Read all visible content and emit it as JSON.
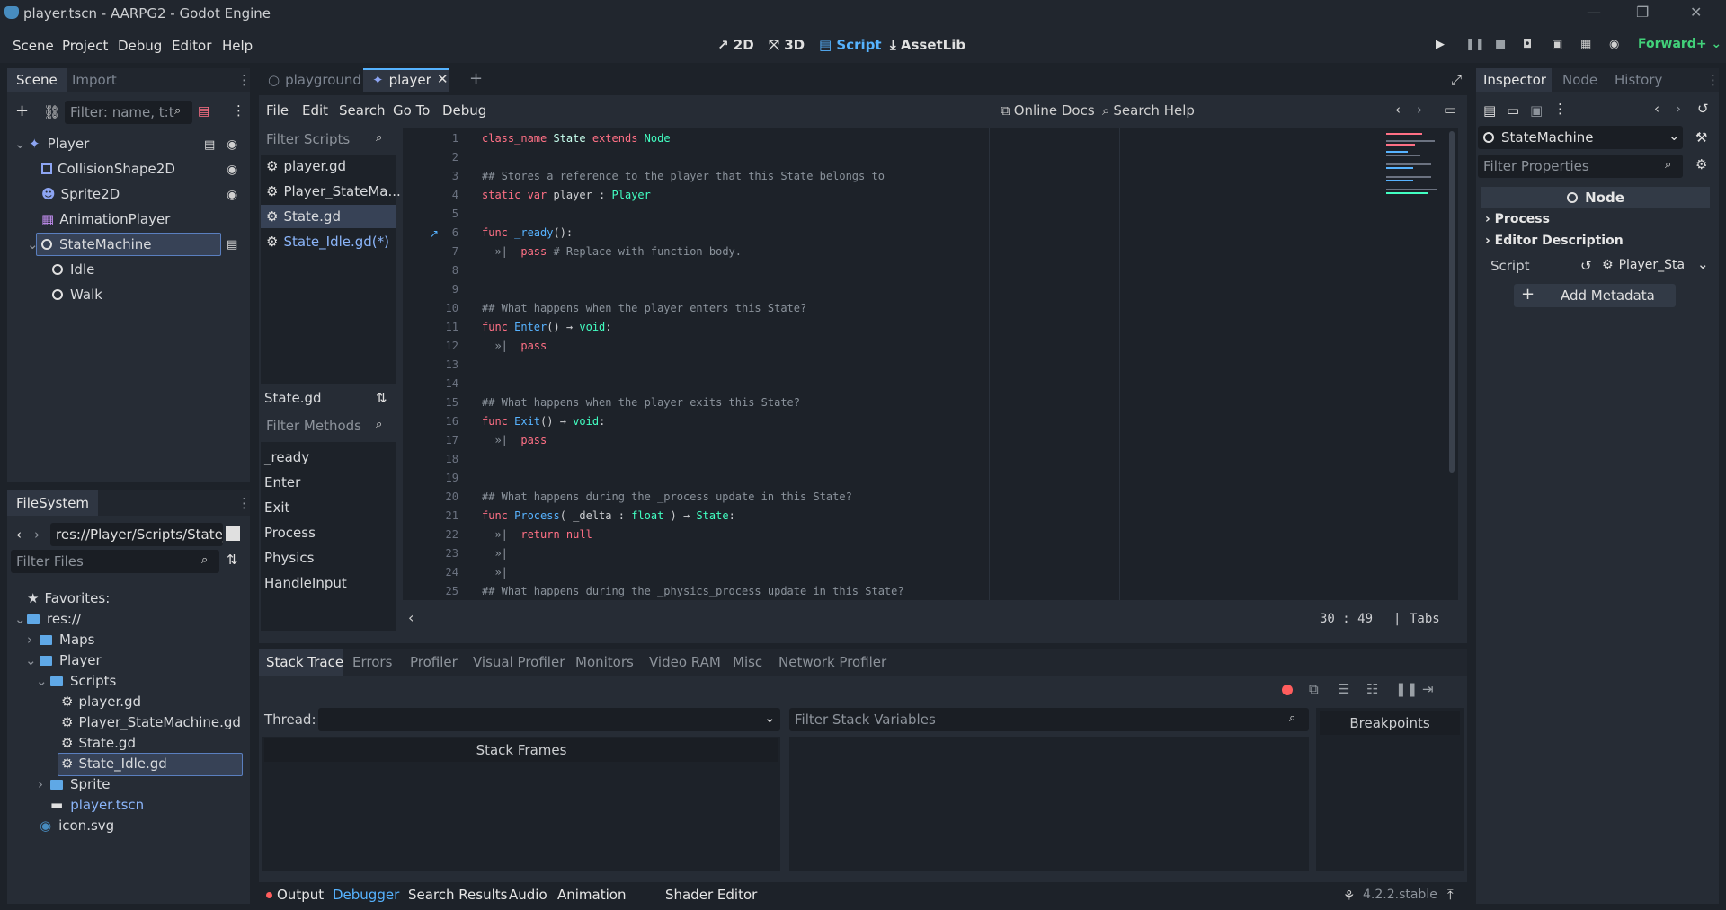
{
  "window": {
    "title": "player.tscn - AARPG2 - Godot Engine",
    "controls": [
      "—",
      "❐",
      "✕"
    ]
  },
  "menubar": {
    "menus": [
      "Scene",
      "Project",
      "Debug",
      "Editor",
      "Help"
    ],
    "main_screens": [
      "2D",
      "3D",
      "Script",
      "AssetLib"
    ],
    "active_screen": "Script",
    "renderer": "Forward+"
  },
  "scene_dock": {
    "tabs": [
      "Scene",
      "Import"
    ],
    "filter_placeholder": "Filter: name, t:t",
    "nodes": [
      {
        "label": "Player",
        "depth": 0
      },
      {
        "label": "CollisionShape2D",
        "depth": 1
      },
      {
        "label": "Sprite2D",
        "depth": 1
      },
      {
        "label": "AnimationPlayer",
        "depth": 1
      },
      {
        "label": "StateMachine",
        "depth": 1,
        "selected": true
      },
      {
        "label": "Idle",
        "depth": 2
      },
      {
        "label": "Walk",
        "depth": 2
      }
    ]
  },
  "filesystem_dock": {
    "tab": "FileSystem",
    "path": "res://Player/Scripts/State_I",
    "filter_placeholder": "Filter Files",
    "items": [
      {
        "label": "Favorites:"
      },
      {
        "label": "res://"
      },
      {
        "label": "Maps"
      },
      {
        "label": "Player"
      },
      {
        "label": "Scripts"
      },
      {
        "label": "player.gd"
      },
      {
        "label": "Player_StateMachine.gd"
      },
      {
        "label": "State.gd"
      },
      {
        "label": "State_Idle.gd",
        "selected": true
      },
      {
        "label": "Sprite"
      },
      {
        "label": "player.tscn"
      },
      {
        "label": "icon.svg"
      }
    ]
  },
  "scene_tabs": [
    "playground",
    "player"
  ],
  "script_menu": [
    "File",
    "Edit",
    "Search",
    "Go To",
    "Debug"
  ],
  "script_toolbar": {
    "online_docs": "Online Docs",
    "search_help": "Search Help"
  },
  "script_list": {
    "filter_placeholder": "Filter Scripts",
    "scripts": [
      "player.gd",
      "Player_StateMa...",
      "State.gd",
      "State_Idle.gd(*)"
    ],
    "current": "State.gd",
    "methods_filter_placeholder": "Filter Methods",
    "methods": [
      "_ready",
      "Enter",
      "Exit",
      "Process",
      "Physics",
      "HandleInput"
    ]
  },
  "code": {
    "line_numbers": [
      "1",
      "2",
      "3",
      "4",
      "5",
      "6",
      "7",
      "8",
      "9",
      "10",
      "11",
      "12",
      "13",
      "14",
      "15",
      "16",
      "17",
      "18",
      "19",
      "20",
      "21",
      "22",
      "23",
      "24",
      "25"
    ],
    "lines": [
      [
        [
          "class_name ",
          "kw"
        ],
        [
          "State ",
          "cls"
        ],
        [
          "extends ",
          "kw"
        ],
        [
          "Node",
          "ty"
        ]
      ],
      [],
      [
        [
          "## Stores a reference to the player that this State belongs to",
          "cm"
        ]
      ],
      [
        [
          "static var ",
          "kw"
        ],
        [
          "player : ",
          "tx"
        ],
        [
          "Player",
          "ty"
        ]
      ],
      [],
      [
        [
          "func ",
          "kw"
        ],
        [
          "_ready",
          "fn"
        ],
        [
          "():",
          "tx"
        ]
      ],
      [
        [
          "  »|  ",
          "cm"
        ],
        [
          "pass ",
          "kw"
        ],
        [
          "# Replace with function body.",
          "cm"
        ]
      ],
      [],
      [],
      [
        [
          "## What happens when the player enters this State?",
          "cm"
        ]
      ],
      [
        [
          "func ",
          "kw"
        ],
        [
          "Enter",
          "fn"
        ],
        [
          "() → ",
          "tx"
        ],
        [
          "void",
          "ty"
        ],
        [
          ":",
          "tx"
        ]
      ],
      [
        [
          "  »|  ",
          "cm"
        ],
        [
          "pass",
          "kw"
        ]
      ],
      [],
      [],
      [
        [
          "## What happens when the player exits this State?",
          "cm"
        ]
      ],
      [
        [
          "func ",
          "kw"
        ],
        [
          "Exit",
          "fn"
        ],
        [
          "() → ",
          "tx"
        ],
        [
          "void",
          "ty"
        ],
        [
          ":",
          "tx"
        ]
      ],
      [
        [
          "  »|  ",
          "cm"
        ],
        [
          "pass",
          "kw"
        ]
      ],
      [],
      [],
      [
        [
          "## What happens during the _process update in this State?",
          "cm"
        ]
      ],
      [
        [
          "func ",
          "kw"
        ],
        [
          "Process",
          "fn"
        ],
        [
          "( _delta : ",
          "tx"
        ],
        [
          "float",
          "ty"
        ],
        [
          " ) → ",
          "tx"
        ],
        [
          "State",
          "ty"
        ],
        [
          ":",
          "tx"
        ]
      ],
      [
        [
          "  »|  ",
          "cm"
        ],
        [
          "return null",
          "kw"
        ]
      ],
      [
        [
          "  »|",
          "cm"
        ]
      ],
      [
        [
          "  »|",
          "cm"
        ]
      ],
      [
        [
          "## What happens during the _physics_process update in this State?",
          "cm"
        ]
      ]
    ],
    "cursor": "30 :   49",
    "indent": "Tabs"
  },
  "debugger": {
    "tabs": [
      "Stack Trace",
      "Errors",
      "Profiler",
      "Visual Profiler",
      "Monitors",
      "Video RAM",
      "Misc",
      "Network Profiler"
    ],
    "thread_label": "Thread:",
    "stack_frames": "Stack Frames",
    "filter_vars_placeholder": "Filter Stack Variables",
    "breakpoints": "Breakpoints"
  },
  "bottom_panel": {
    "tabs": [
      "Output",
      "Debugger",
      "Search Results",
      "Audio",
      "Animation",
      "Shader Editor"
    ],
    "active": "Debugger",
    "version": "4.2.2.stable"
  },
  "inspector": {
    "tabs": [
      "Inspector",
      "Node",
      "History"
    ],
    "object": "StateMachine",
    "filter_placeholder": "Filter Properties",
    "class_header": "Node",
    "sections": [
      "Process",
      "Editor Description"
    ],
    "script_label": "Script",
    "script_value": "Player_Sta",
    "add_metadata": "Add Metadata"
  },
  "colors": {
    "accent": "#56b3ff",
    "keyword": "#ff7085",
    "comment": "#8b939c",
    "type": "#42ffc2",
    "function": "#57b3ff"
  }
}
